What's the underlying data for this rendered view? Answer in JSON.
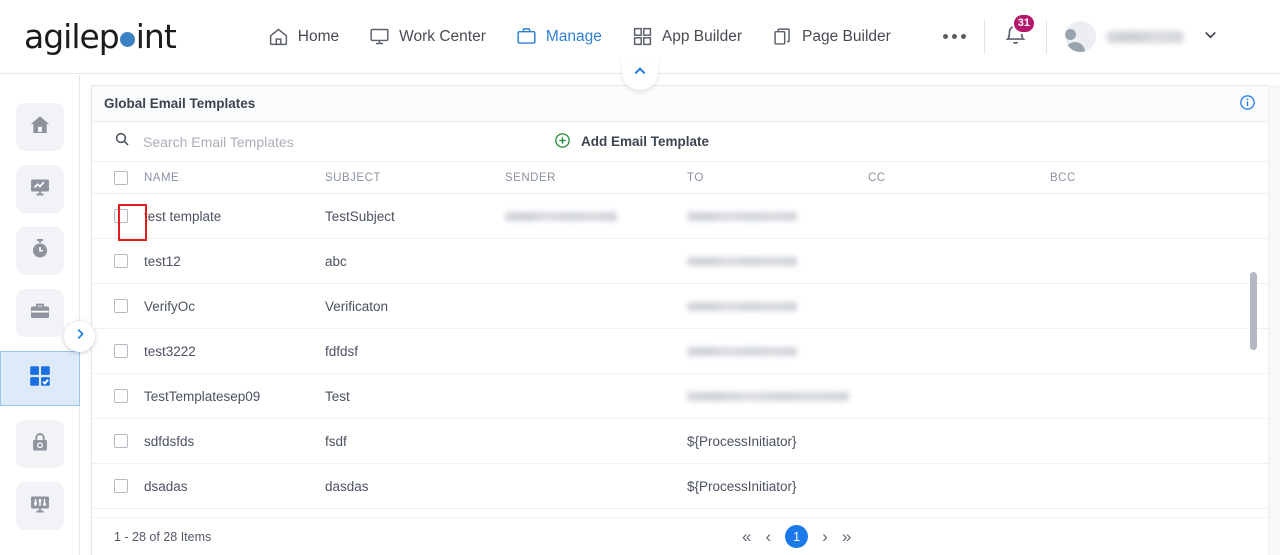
{
  "brand": {
    "name": "agilepoint",
    "name_part1": "agilep",
    "name_part2": "int",
    "dot_color": "#3b82c4"
  },
  "topnav": {
    "items": [
      {
        "label": "Home",
        "icon": "home-icon",
        "active": false
      },
      {
        "label": "Work Center",
        "icon": "monitor-icon",
        "active": false
      },
      {
        "label": "Manage",
        "icon": "briefcase-icon",
        "active": true
      },
      {
        "label": "App Builder",
        "icon": "grid-icon",
        "active": false
      },
      {
        "label": "Page Builder",
        "icon": "pages-icon",
        "active": false
      }
    ],
    "more_label": "•••",
    "notification_count": "31",
    "username": "",
    "accent_color": "#2f7fd1",
    "badge_color": "#b5176b"
  },
  "rail": {
    "items": [
      {
        "name": "home",
        "icon": "home-icon",
        "active": false
      },
      {
        "name": "analytics",
        "icon": "chart-monitor-icon",
        "active": false
      },
      {
        "name": "timer",
        "icon": "stopwatch-icon",
        "active": false
      },
      {
        "name": "work",
        "icon": "briefcase-icon",
        "active": false
      },
      {
        "name": "apps",
        "icon": "app-grid-check-icon",
        "active": true
      },
      {
        "name": "access",
        "icon": "lock-icon",
        "active": false
      },
      {
        "name": "settings",
        "icon": "sliders-icon",
        "active": false
      }
    ]
  },
  "panel": {
    "title": "Global Email Templates",
    "info_icon": "info-icon"
  },
  "toolbar": {
    "search_placeholder": "Search Email Templates",
    "search_value": "",
    "search_icon": "search-icon",
    "add_label": "Add Email Template",
    "add_icon": "plus-circle-icon",
    "add_icon_color": "#1b8a35"
  },
  "table": {
    "columns": [
      "NAME",
      "SUBJECT",
      "SENDER",
      "TO",
      "CC",
      "BCC"
    ],
    "rows": [
      {
        "name": "test template",
        "subject": "TestSubject",
        "sender": "[redacted]",
        "sender_blur": true,
        "to": "[redacted]",
        "to_blur": true,
        "cc": "",
        "bcc": ""
      },
      {
        "name": "test12",
        "subject": "abc",
        "sender": "",
        "sender_blur": false,
        "to": "[redacted]",
        "to_blur": true,
        "cc": "",
        "bcc": ""
      },
      {
        "name": "VerifyOc",
        "subject": "Verificaton",
        "sender": "",
        "sender_blur": false,
        "to": "[redacted]",
        "to_blur": true,
        "cc": "",
        "bcc": ""
      },
      {
        "name": "test3222",
        "subject": "fdfdsf",
        "sender": "",
        "sender_blur": false,
        "to": "[redacted]",
        "to_blur": true,
        "cc": "",
        "bcc": ""
      },
      {
        "name": "TestTemplatesep09",
        "subject": "Test",
        "sender": "",
        "sender_blur": false,
        "to": "[redacted]",
        "to_blur": true,
        "cc": "",
        "bcc": ""
      },
      {
        "name": "sdfdsfds",
        "subject": "fsdf",
        "sender": "",
        "sender_blur": false,
        "to": "${ProcessInitiator}",
        "to_blur": false,
        "cc": "",
        "bcc": ""
      },
      {
        "name": "dsadas",
        "subject": "dasdas",
        "sender": "",
        "sender_blur": false,
        "to": "${ProcessInitiator}",
        "to_blur": false,
        "cc": "",
        "bcc": ""
      }
    ]
  },
  "footer": {
    "count_text": "1 - 28 of 28 Items",
    "first_label": "«",
    "prev_label": "‹",
    "current_page": "1",
    "next_label": "›",
    "last_label": "»"
  },
  "highlight": {
    "color": "#e21d1d",
    "target": "first-row-checkbox"
  }
}
